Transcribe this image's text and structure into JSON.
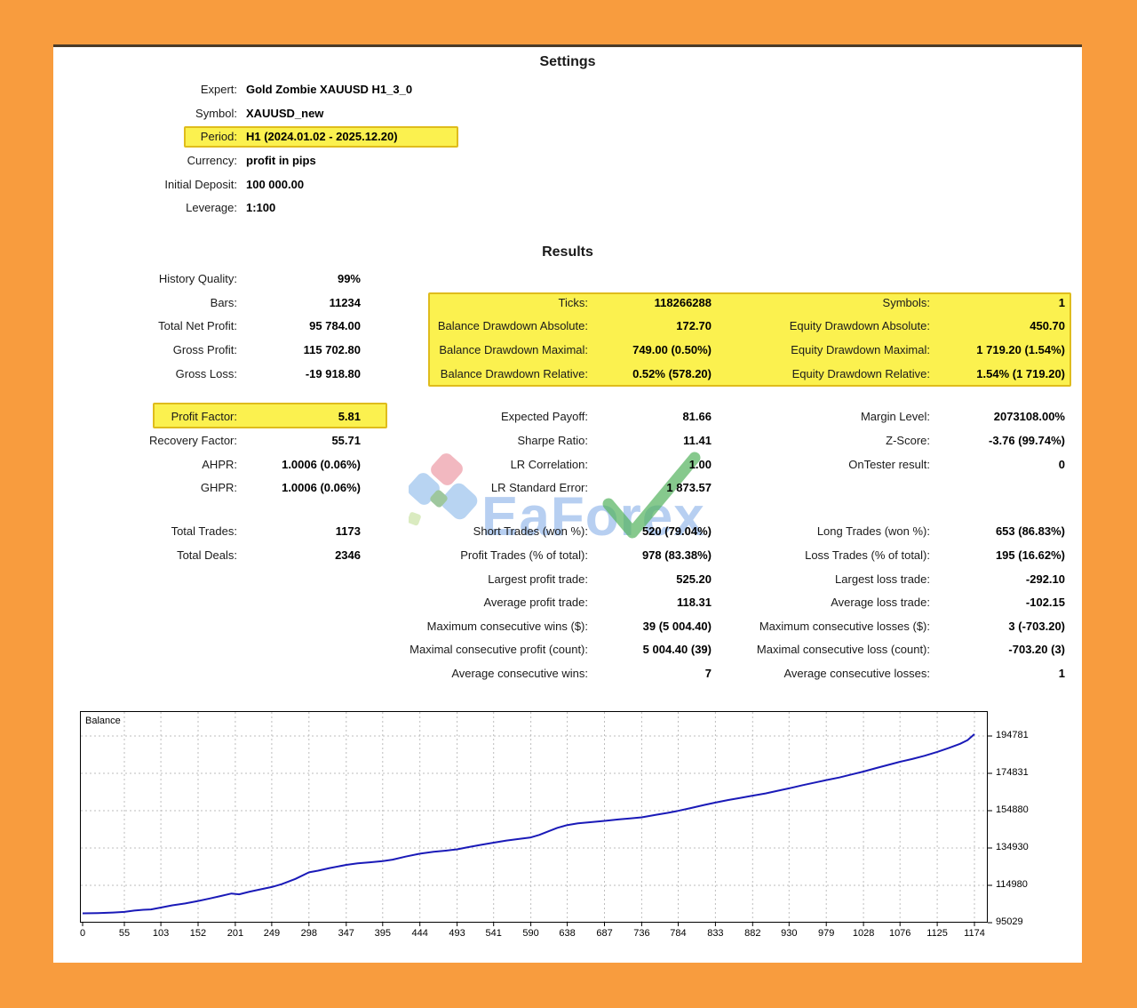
{
  "frame": {
    "bg_color": "#F89C3E",
    "highlight_color": "#FBF14F"
  },
  "settings": {
    "title": "Settings",
    "rows": [
      {
        "label": "Expert:",
        "value": "Gold Zombie XAUUSD H1_3_0"
      },
      {
        "label": "Symbol:",
        "value": "XAUUSD_new"
      },
      {
        "label": "Period:",
        "value": "H1 (2024.01.02 - 2025.12.20)",
        "highlighted": true
      },
      {
        "label": "Currency:",
        "value": "profit in pips"
      },
      {
        "label": "Initial Deposit:",
        "value": "100 000.00"
      },
      {
        "label": "Leverage:",
        "value": "1:100"
      }
    ]
  },
  "results": {
    "title": "Results",
    "left": [
      {
        "label": "History Quality:",
        "value": "99%"
      },
      {
        "label": "Bars:",
        "value": "11234"
      },
      {
        "label": "Total Net Profit:",
        "value": "95 784.00"
      },
      {
        "label": "Gross Profit:",
        "value": "115 702.80"
      },
      {
        "label": "Gross Loss:",
        "value": "-19 918.80"
      },
      {
        "label": "Profit Factor:",
        "value": "5.81",
        "highlighted": true
      },
      {
        "label": "Recovery Factor:",
        "value": "55.71"
      },
      {
        "label": "AHPR:",
        "value": "1.0006 (0.06%)"
      },
      {
        "label": "GHPR:",
        "value": "1.0006 (0.06%)"
      },
      {
        "label": "Total Trades:",
        "value": "1173"
      },
      {
        "label": "Total Deals:",
        "value": "2346"
      }
    ],
    "middle": [
      {
        "label": "Ticks:",
        "value": "118266288"
      },
      {
        "label": "Balance Drawdown Absolute:",
        "value": "172.70"
      },
      {
        "label": "Balance Drawdown Maximal:",
        "value": "749.00 (0.50%)"
      },
      {
        "label": "Balance Drawdown Relative:",
        "value": "0.52% (578.20)"
      },
      {
        "label": "Expected Payoff:",
        "value": "81.66"
      },
      {
        "label": "Sharpe Ratio:",
        "value": "11.41"
      },
      {
        "label": "LR Correlation:",
        "value": "1.00"
      },
      {
        "label": "LR Standard Error:",
        "value": "1 873.57"
      },
      {
        "label": "Short Trades (won %):",
        "value": "520 (79.04%)"
      },
      {
        "label": "Profit Trades (% of total):",
        "value": "978 (83.38%)"
      },
      {
        "label": "Largest profit trade:",
        "value": "525.20"
      },
      {
        "label": "Average profit trade:",
        "value": "118.31"
      },
      {
        "label": "Maximum consecutive wins ($):",
        "value": "39 (5 004.40)"
      },
      {
        "label": "Maximal consecutive profit (count):",
        "value": "5 004.40 (39)"
      },
      {
        "label": "Average consecutive wins:",
        "value": "7"
      }
    ],
    "right": [
      {
        "label": "Symbols:",
        "value": "1"
      },
      {
        "label": "Equity Drawdown Absolute:",
        "value": "450.70"
      },
      {
        "label": "Equity Drawdown Maximal:",
        "value": "1 719.20 (1.54%)"
      },
      {
        "label": "Equity Drawdown Relative:",
        "value": "1.54% (1 719.20)"
      },
      {
        "label": "Margin Level:",
        "value": "2073108.00%"
      },
      {
        "label": "Z-Score:",
        "value": "-3.76 (99.74%)"
      },
      {
        "label": "OnTester result:",
        "value": "0"
      },
      {
        "label": "Long Trades (won %):",
        "value": "653 (86.83%)"
      },
      {
        "label": "Loss Trades (% of total):",
        "value": "195 (16.62%)"
      },
      {
        "label": "Largest loss trade:",
        "value": "-292.10"
      },
      {
        "label": "Average loss trade:",
        "value": "-102.15"
      },
      {
        "label": "Maximum consecutive losses ($):",
        "value": "3 (-703.20)"
      },
      {
        "label": "Maximal consecutive loss (count):",
        "value": "-703.20 (3)"
      },
      {
        "label": "Average consecutive losses:",
        "value": "1"
      }
    ]
  },
  "watermark": {
    "text": "EaForex",
    "text_color": "#7da9e6",
    "check_color": "#53b25c"
  },
  "chart_data": {
    "type": "line",
    "title": "Balance",
    "xlabel": "",
    "ylabel": "",
    "grid": true,
    "line_color": "#1a1ab8",
    "x_ticks": [
      0,
      55,
      103,
      152,
      201,
      249,
      298,
      347,
      395,
      444,
      493,
      541,
      590,
      638,
      687,
      736,
      784,
      833,
      882,
      930,
      979,
      1028,
      1076,
      1125,
      1174
    ],
    "y_ticks": [
      95029,
      114980,
      134930,
      154880,
      174831,
      194781
    ],
    "series": [
      {
        "name": "Balance",
        "points": [
          [
            0,
            100000
          ],
          [
            20,
            100150
          ],
          [
            40,
            100450
          ],
          [
            55,
            100800
          ],
          [
            68,
            101500
          ],
          [
            80,
            101900
          ],
          [
            90,
            102100
          ],
          [
            103,
            103100
          ],
          [
            118,
            104300
          ],
          [
            135,
            105300
          ],
          [
            152,
            106600
          ],
          [
            168,
            108000
          ],
          [
            182,
            109300
          ],
          [
            196,
            110600
          ],
          [
            206,
            110200
          ],
          [
            220,
            111600
          ],
          [
            235,
            112900
          ],
          [
            249,
            114100
          ],
          [
            262,
            115600
          ],
          [
            280,
            118400
          ],
          [
            298,
            121900
          ],
          [
            310,
            122800
          ],
          [
            325,
            124200
          ],
          [
            347,
            125900
          ],
          [
            362,
            126700
          ],
          [
            378,
            127300
          ],
          [
            395,
            127900
          ],
          [
            408,
            128700
          ],
          [
            425,
            130300
          ],
          [
            444,
            131900
          ],
          [
            462,
            132900
          ],
          [
            478,
            133500
          ],
          [
            493,
            134200
          ],
          [
            508,
            135400
          ],
          [
            524,
            136600
          ],
          [
            541,
            137800
          ],
          [
            558,
            138900
          ],
          [
            575,
            139800
          ],
          [
            590,
            140600
          ],
          [
            601,
            141900
          ],
          [
            613,
            143800
          ],
          [
            625,
            145700
          ],
          [
            638,
            147200
          ],
          [
            652,
            148100
          ],
          [
            668,
            148700
          ],
          [
            687,
            149400
          ],
          [
            705,
            150200
          ],
          [
            722,
            150800
          ],
          [
            736,
            151300
          ],
          [
            755,
            152700
          ],
          [
            770,
            153700
          ],
          [
            784,
            154800
          ],
          [
            801,
            156300
          ],
          [
            818,
            157900
          ],
          [
            833,
            159200
          ],
          [
            850,
            160600
          ],
          [
            866,
            161700
          ],
          [
            882,
            162900
          ],
          [
            899,
            164100
          ],
          [
            915,
            165500
          ],
          [
            930,
            166800
          ],
          [
            948,
            168500
          ],
          [
            965,
            170000
          ],
          [
            979,
            171200
          ],
          [
            996,
            172600
          ],
          [
            1012,
            174200
          ],
          [
            1028,
            175800
          ],
          [
            1045,
            177700
          ],
          [
            1060,
            179300
          ],
          [
            1076,
            181000
          ],
          [
            1092,
            182500
          ],
          [
            1108,
            184200
          ],
          [
            1125,
            186300
          ],
          [
            1140,
            188300
          ],
          [
            1155,
            190600
          ],
          [
            1165,
            192600
          ],
          [
            1174,
            195780
          ]
        ]
      }
    ]
  }
}
